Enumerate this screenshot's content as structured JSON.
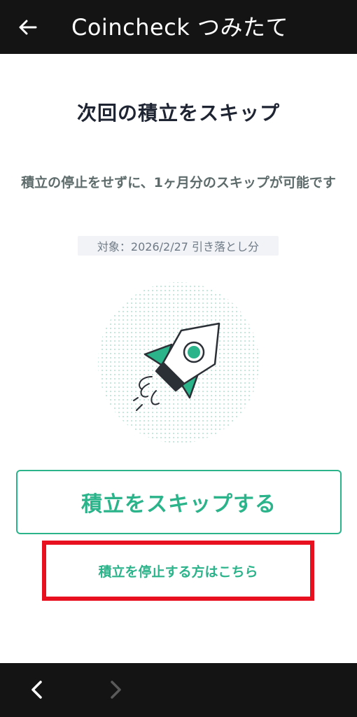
{
  "app_bar": {
    "title": "Coincheck つみたて",
    "back_icon": "arrow-left-icon"
  },
  "main": {
    "heading": "次回の積立をスキップ",
    "description": "積立の停止をせずに、1ヶ月分のスキップが可能です",
    "target": "対象：2026/2/27 引き落とし分",
    "illustration": "rocket-icon",
    "skip_button_label": "積立をスキップする",
    "stop_link_label": "積立を停止する方はこちら"
  },
  "nav_bar": {
    "back_icon": "chevron-left-icon",
    "forward_icon": "chevron-right-icon"
  },
  "colors": {
    "accent": "#2bb38a",
    "highlight_box": "#e8101f",
    "bar_background": "#141414"
  }
}
